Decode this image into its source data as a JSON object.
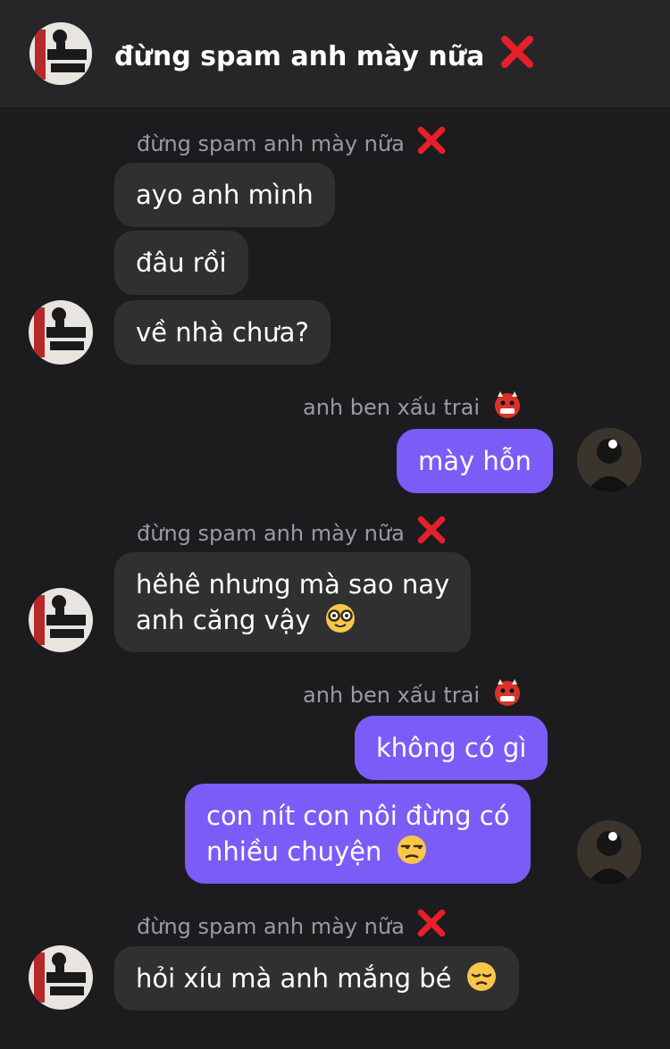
{
  "header": {
    "title": "đừng spam anh mày nữa"
  },
  "contacts": {
    "friend": "đừng spam anh mày nữa",
    "me": "anh ben xấu trai"
  },
  "messages": [
    "ayo anh mình",
    "đâu rồi",
    "về nhà chưa?",
    "mày hỗn",
    "hêhê nhưng mà sao nay",
    "anh căng vậy",
    "không có gì",
    "con nít con nôi đừng có",
    "nhiều chuyện",
    "hỏi xíu mà anh mắng bé"
  ],
  "icons": {
    "friend_name_suffix": "cross-mark-icon",
    "me_name_suffix": "ogre-emoji-icon",
    "emoji_nerd": "nerd-face-emoji-icon",
    "emoji_unamused": "unamused-face-emoji-icon",
    "emoji_pensive": "pensive-face-emoji-icon"
  },
  "colors": {
    "background": "#1c1c1e",
    "header": "#262628",
    "incoming_bubble": "#303032",
    "outgoing_bubble": "#7c5cf6",
    "cross": "#e5202a"
  }
}
